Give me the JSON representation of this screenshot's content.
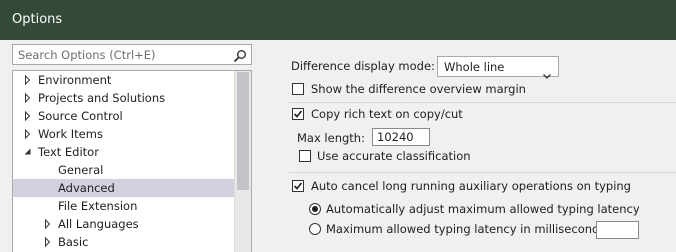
{
  "window": {
    "title": "Options"
  },
  "search": {
    "placeholder": "Search Options (Ctrl+E)"
  },
  "tree": {
    "items": [
      {
        "label": "Environment",
        "expander": "collapsed"
      },
      {
        "label": "Projects and Solutions",
        "expander": "collapsed"
      },
      {
        "label": "Source Control",
        "expander": "collapsed"
      },
      {
        "label": "Work Items",
        "expander": "collapsed"
      },
      {
        "label": "Text Editor",
        "expander": "expanded"
      },
      {
        "label": "General",
        "expander": "none"
      },
      {
        "label": "Advanced",
        "expander": "none",
        "selected": true
      },
      {
        "label": "File Extension",
        "expander": "none"
      },
      {
        "label": "All Languages",
        "expander": "collapsed"
      },
      {
        "label": "Basic",
        "expander": "collapsed"
      }
    ]
  },
  "settings": {
    "diff_mode_label": "Difference display mode:",
    "diff_mode_value": "Whole line",
    "show_overview_margin": {
      "label": "Show the difference overview margin",
      "checked": false
    },
    "copy_rich_text": {
      "label": "Copy rich text on copy/cut",
      "checked": true
    },
    "max_length_label": "Max length:",
    "max_length_value": "10240",
    "accurate_classification": {
      "label": "Use accurate classification",
      "checked": false
    },
    "auto_cancel": {
      "label": "Auto cancel long running auxiliary operations on typing",
      "checked": true
    },
    "auto_adjust_latency": {
      "label": "Automatically adjust maximum allowed typing latency",
      "selected": true
    },
    "max_latency": {
      "label": "Maximum allowed typing latency in milliseconds:",
      "selected": false,
      "value": ""
    }
  },
  "colors": {
    "titlebar": "#344a39",
    "panel": "#f0f0f0",
    "selection": "#d2d2de"
  }
}
